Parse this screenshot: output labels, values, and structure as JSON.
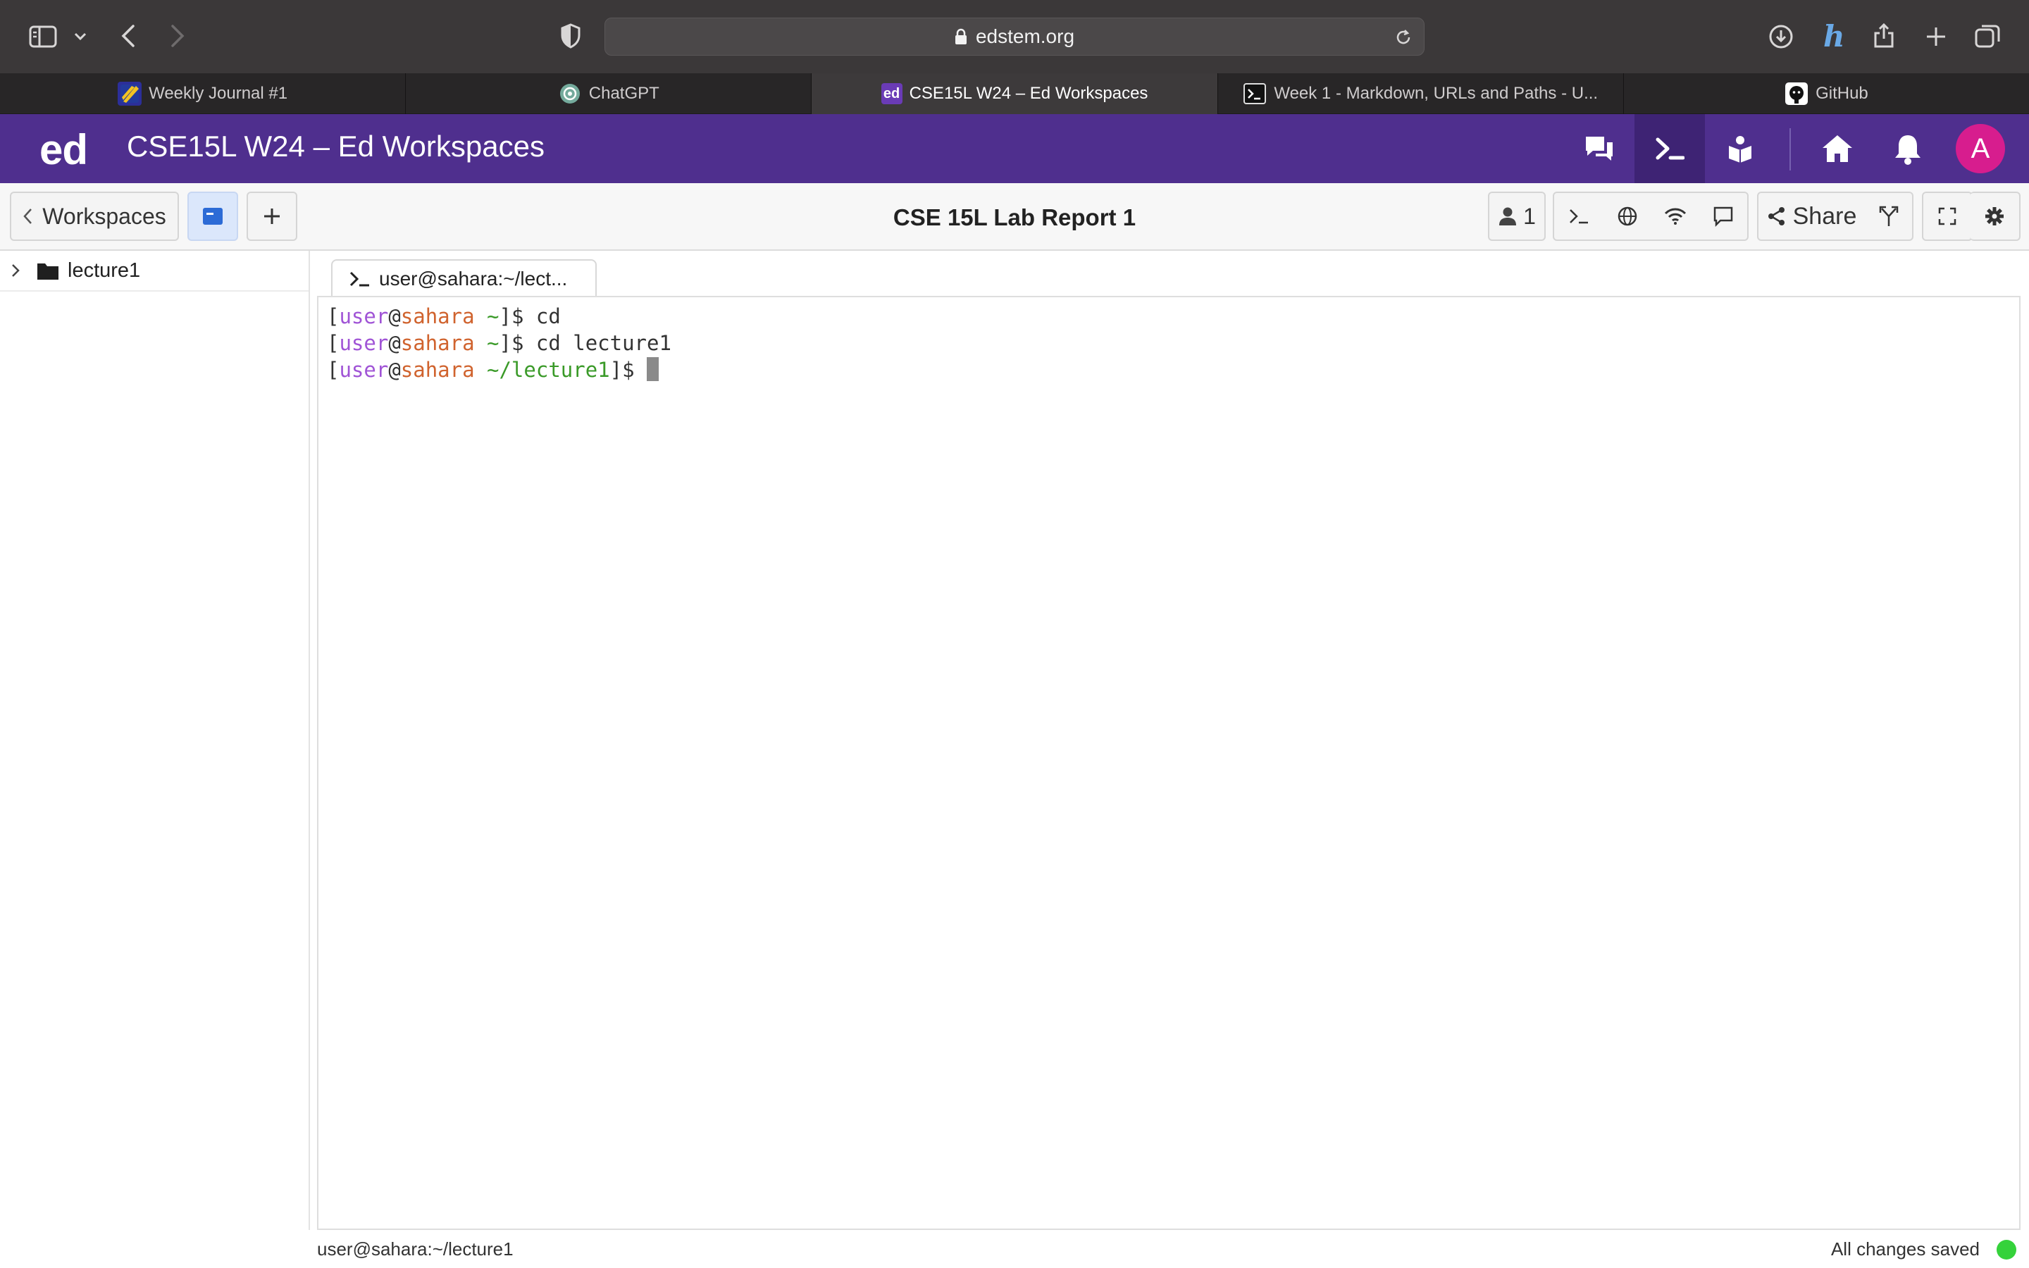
{
  "browser": {
    "url": "edstem.org",
    "tabs": [
      {
        "label": "Weekly Journal #1",
        "icon": "journal-favicon",
        "active": false
      },
      {
        "label": "ChatGPT",
        "icon": "chatgpt-favicon",
        "active": false
      },
      {
        "label": "CSE15L W24 – Ed Workspaces",
        "icon": "ed-favicon",
        "active": true
      },
      {
        "label": "Week 1 - Markdown, URLs and Paths - U...",
        "icon": "terminal-favicon",
        "active": false
      },
      {
        "label": "GitHub",
        "icon": "github-favicon",
        "active": false
      }
    ],
    "ed_favicon_text": "ed"
  },
  "header": {
    "logo": "ed",
    "title": "CSE15L W24 – Ed Workspaces",
    "avatar_initial": "A",
    "accent_color": "#4f2f8e"
  },
  "workspace": {
    "back_label": "Workspaces",
    "title": "CSE 15L Lab Report 1",
    "users_count": "1",
    "share_label": "Share"
  },
  "sidebar": {
    "items": [
      {
        "label": "lecture1",
        "type": "folder"
      }
    ]
  },
  "terminal": {
    "tab_label": "user@sahara:~/lect...",
    "lines": [
      {
        "user": "user",
        "host": "sahara",
        "path": "~",
        "command": "cd"
      },
      {
        "user": "user",
        "host": "sahara",
        "path": "~",
        "command": "cd lecture1"
      },
      {
        "user": "user",
        "host": "sahara",
        "path": "~/lecture1",
        "command": ""
      }
    ]
  },
  "status": {
    "left": "user@sahara:~/lecture1",
    "right": "All changes saved",
    "saved_color": "#35d23b"
  }
}
